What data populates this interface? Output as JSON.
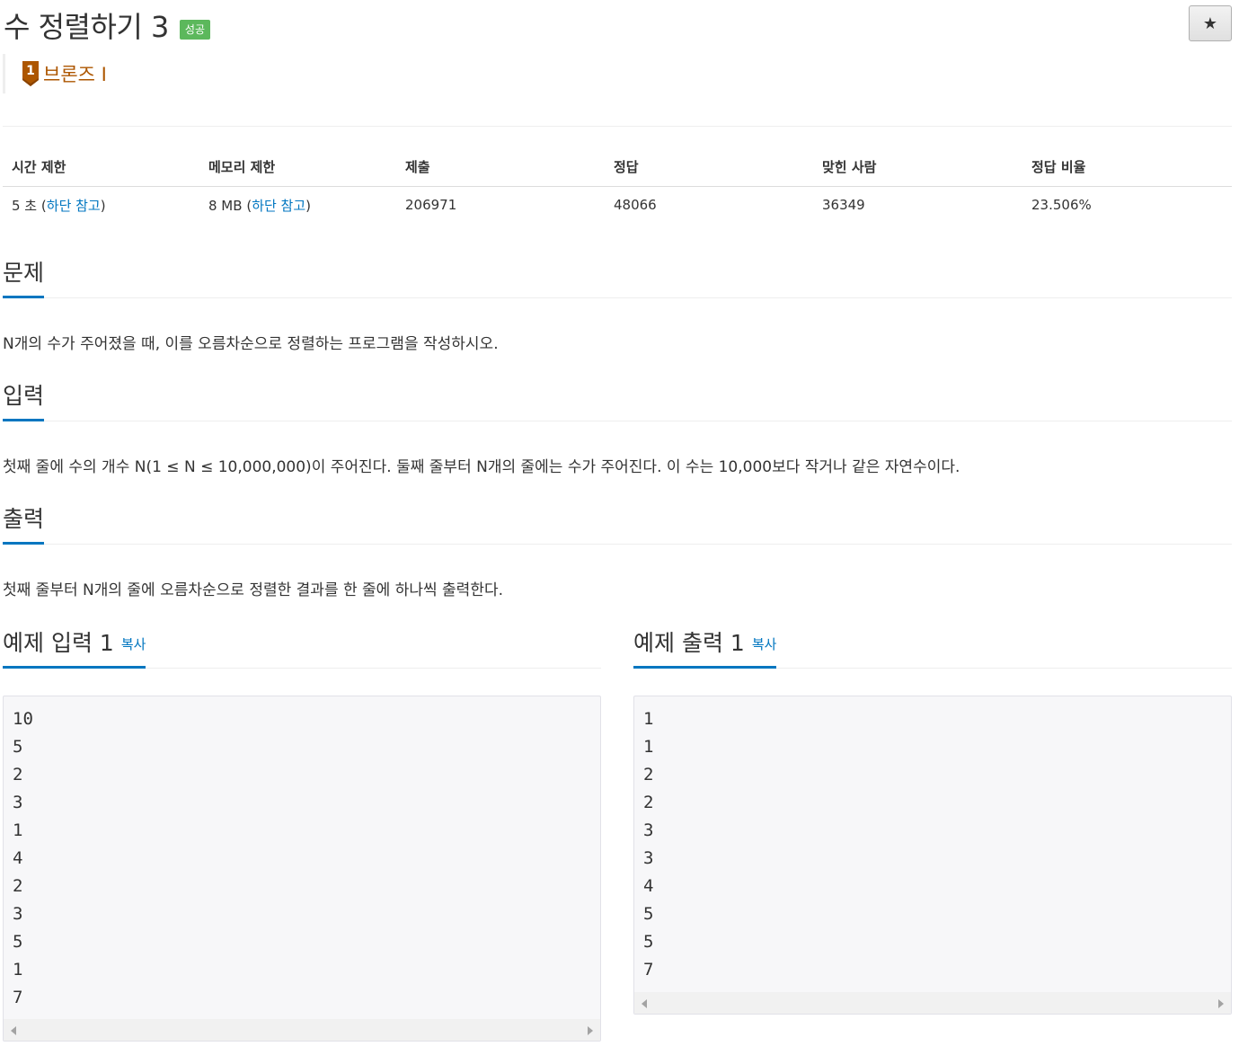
{
  "problem": {
    "title": "수 정렬하기 3",
    "status_badge": "성공",
    "star_icon": "★",
    "tier_number": "1",
    "tier_label": "브론즈 I"
  },
  "info": {
    "headers": [
      "시간 제한",
      "메모리 제한",
      "제출",
      "정답",
      "맞힌 사람",
      "정답 비율"
    ],
    "time_limit": "5 초",
    "memory_limit": "8 MB",
    "paren_open": "(",
    "paren_close": ")",
    "footnote_link": "하단 참고",
    "submissions": "206971",
    "accepted": "48066",
    "solved_users": "36349",
    "ratio": "23.506%"
  },
  "sections": {
    "problem_heading": "문제",
    "problem_text": "N개의 수가 주어졌을 때, 이를 오름차순으로 정렬하는 프로그램을 작성하시오.",
    "input_heading": "입력",
    "input_text": "첫째 줄에 수의 개수 N(1 ≤ N ≤ 10,000,000)이 주어진다. 둘째 줄부터 N개의 줄에는 수가 주어진다. 이 수는 10,000보다 작거나 같은 자연수이다.",
    "output_heading": "출력",
    "output_text": "첫째 줄부터 N개의 줄에 오름차순으로 정렬한 결과를 한 줄에 하나씩 출력한다."
  },
  "samples": {
    "input_heading": "예제 입력 1",
    "output_heading": "예제 출력 1",
    "copy_label": "복사",
    "input_lines": [
      "10",
      "5",
      "2",
      "3",
      "1",
      "4",
      "2",
      "3",
      "5",
      "1",
      "7"
    ],
    "output_lines": [
      "1",
      "1",
      "2",
      "2",
      "3",
      "3",
      "4",
      "5",
      "5",
      "7"
    ]
  },
  "colors": {
    "link": "#0076c0",
    "success": "#5cb85c",
    "bronze": "#ad5600"
  }
}
